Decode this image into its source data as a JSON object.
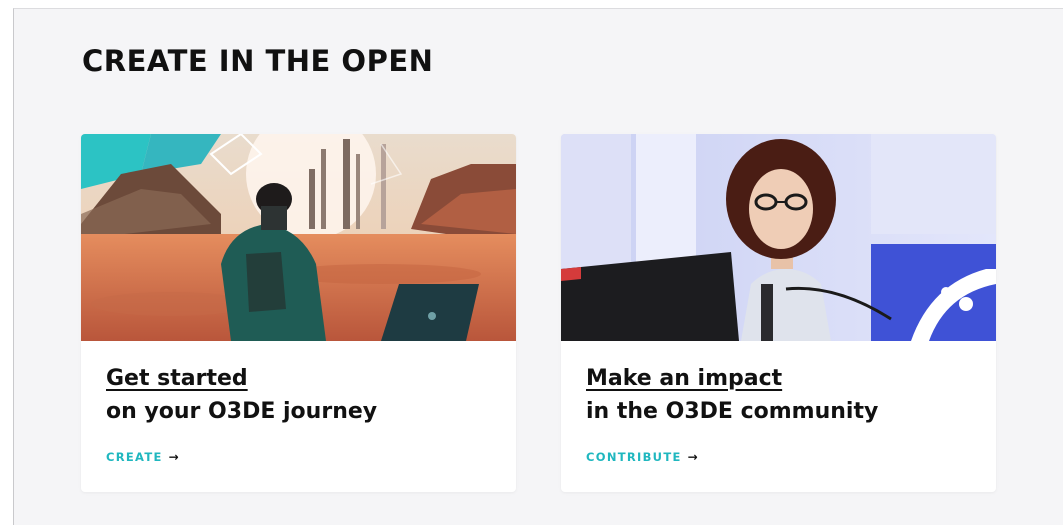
{
  "section": {
    "title": "CREATE IN THE OPEN"
  },
  "cards": [
    {
      "link_text": "Get started",
      "subtitle": "on your O3DE journey",
      "cta_label": "CREATE",
      "cta_arrow": "→",
      "image_subject": "person-with-laptop-in-desert-landscape"
    },
    {
      "link_text": "Make an impact",
      "subtitle": "in the O3DE community",
      "cta_label": "CONTRIBUTE",
      "cta_arrow": "→",
      "image_subject": "speaker-with-laptop-at-podium"
    }
  ],
  "colors": {
    "accent": "#1fb7bf",
    "text": "#111111",
    "background": "#f5f5f7",
    "card": "#ffffff"
  }
}
